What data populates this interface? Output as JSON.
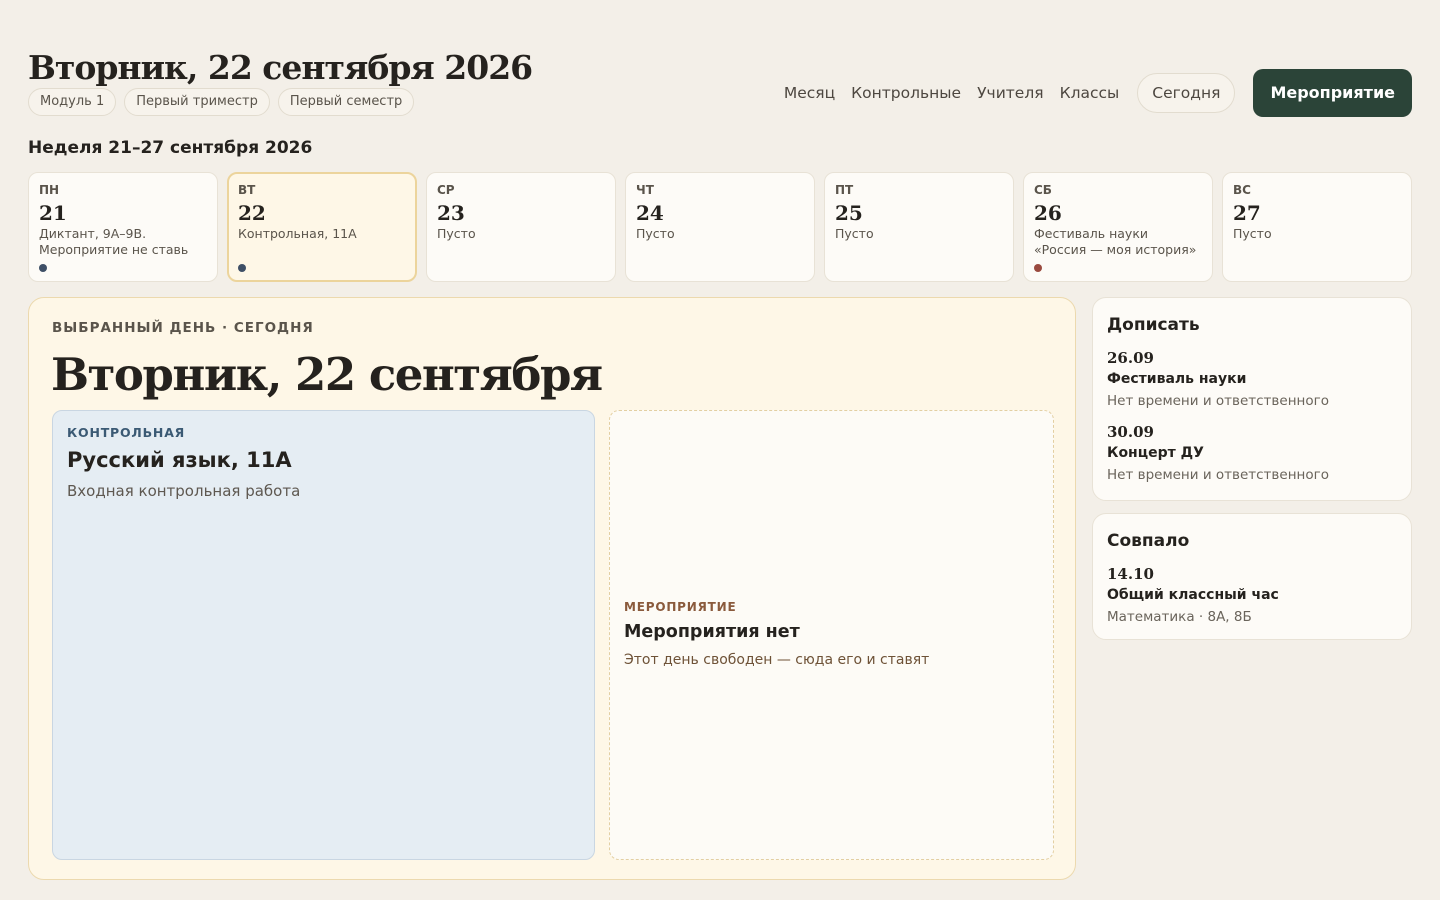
{
  "header": {
    "title": "Вторник, 22 сентября 2026",
    "chips": [
      "Модуль 1",
      "Первый триместр",
      "Первый семестр"
    ]
  },
  "nav": {
    "links": [
      "Месяц",
      "Контрольные",
      "Учителя",
      "Классы"
    ],
    "today_label": "Сегодня",
    "event_label": "Мероприятие"
  },
  "week": {
    "label": "Неделя 21–27 сентября 2026",
    "days": [
      {
        "abbr": "ПН",
        "num": "21",
        "note": "Диктант, 9А–9В. Мероприятие не ставь",
        "dot": "#3e4f66",
        "selected": false
      },
      {
        "abbr": "ВТ",
        "num": "22",
        "note": "Контрольная, 11А",
        "dot": "#3e4f66",
        "selected": true
      },
      {
        "abbr": "СР",
        "num": "23",
        "note": "Пусто",
        "dot": "",
        "selected": false
      },
      {
        "abbr": "ЧТ",
        "num": "24",
        "note": "Пусто",
        "dot": "",
        "selected": false
      },
      {
        "abbr": "ПТ",
        "num": "25",
        "note": "Пусто",
        "dot": "",
        "selected": false
      },
      {
        "abbr": "СБ",
        "num": "26",
        "note": "Фестиваль науки «Россия — моя история»",
        "dot": "#9a4a3f",
        "selected": false
      },
      {
        "abbr": "ВС",
        "num": "27",
        "note": "Пусто",
        "dot": "",
        "selected": false
      }
    ]
  },
  "selected_day": {
    "kicker": "ВЫБРАННЫЙ ДЕНЬ · СЕГОДНЯ",
    "title": "Вторник, 22 сентября",
    "control": {
      "kicker": "КОНТРОЛЬНАЯ",
      "title": "Русский язык, 11А",
      "description": "Входная контрольная работа"
    },
    "event": {
      "kicker": "МЕРОПРИЯТИЕ",
      "title": "Мероприятия нет",
      "description": "Этот день свободен — сюда его и ставят"
    }
  },
  "todo_panel": {
    "title": "Дописать",
    "items": [
      {
        "date": "26.09",
        "name": "Фестиваль науки",
        "note": "Нет времени и ответственного"
      },
      {
        "date": "30.09",
        "name": "Концерт ДУ",
        "note": "Нет времени и ответственного"
      }
    ]
  },
  "match_panel": {
    "title": "Совпало",
    "items": [
      {
        "date": "14.10",
        "name": "Общий классный час",
        "note": "Математика · 8А, 8Б"
      }
    ]
  }
}
